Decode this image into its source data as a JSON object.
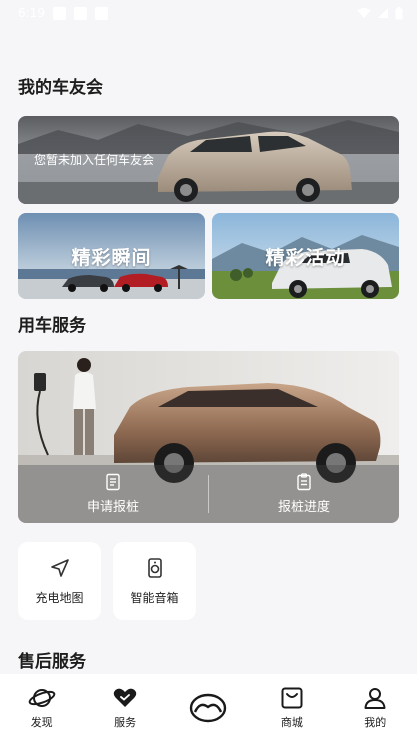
{
  "status_bar": {
    "time": "6:19"
  },
  "sections": {
    "car_club_title": "我的车友会",
    "car_service_title": "用车服务",
    "after_sales_title": "售后服务"
  },
  "club_banner": {
    "text": "您暂未加入任何车友会"
  },
  "tiles": [
    {
      "label": "精彩瞬间"
    },
    {
      "label": "精彩活动"
    }
  ],
  "service_banner": {
    "actions": [
      {
        "label": "申请报桩",
        "icon": "document-icon"
      },
      {
        "label": "报桩进度",
        "icon": "checklist-icon"
      }
    ]
  },
  "quick_services": [
    {
      "label": "充电地图",
      "icon": "navigation-arrow-icon"
    },
    {
      "label": "智能音箱",
      "icon": "speaker-icon"
    }
  ],
  "tab_bar": {
    "items": [
      {
        "label": "发现",
        "icon": "planet-icon"
      },
      {
        "label": "服务",
        "icon": "heart-icon",
        "active": true
      },
      {
        "label": "",
        "icon": "mazda-logo-icon"
      },
      {
        "label": "商城",
        "icon": "mall-icon"
      },
      {
        "label": "我的",
        "icon": "profile-icon"
      }
    ]
  },
  "colors": {
    "background": "#f6f6f8",
    "text": "#1a1a1a",
    "white": "#ffffff"
  }
}
